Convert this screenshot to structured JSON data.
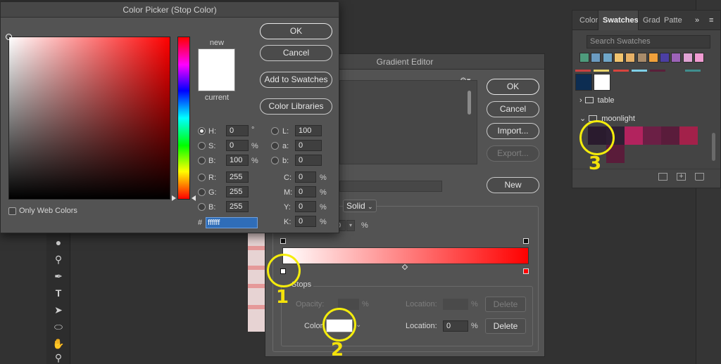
{
  "color_picker": {
    "title": "Color Picker (Stop Color)",
    "new_label": "new",
    "current_label": "current",
    "buttons": {
      "ok": "OK",
      "cancel": "Cancel",
      "add_to_swatches": "Add to Swatches",
      "color_libraries": "Color Libraries"
    },
    "only_web_colors": "Only Web Colors",
    "hsb": [
      {
        "label": "H:",
        "value": "0",
        "unit": "°",
        "selected": true
      },
      {
        "label": "S:",
        "value": "0",
        "unit": "%",
        "selected": false
      },
      {
        "label": "B:",
        "value": "100",
        "unit": "%",
        "selected": false
      }
    ],
    "rgb": [
      {
        "label": "R:",
        "value": "255"
      },
      {
        "label": "G:",
        "value": "255"
      },
      {
        "label": "B:",
        "value": "255"
      }
    ],
    "lab": [
      {
        "label": "L:",
        "value": "100"
      },
      {
        "label": "a:",
        "value": "0"
      },
      {
        "label": "b:",
        "value": "0"
      }
    ],
    "cmyk": [
      {
        "label": "C:",
        "value": "0",
        "unit": "%"
      },
      {
        "label": "M:",
        "value": "0",
        "unit": "%"
      },
      {
        "label": "Y:",
        "value": "0",
        "unit": "%"
      },
      {
        "label": "K:",
        "value": "0",
        "unit": "%"
      }
    ],
    "hex_prefix": "#",
    "hex_value": "ffffff"
  },
  "gradient_editor": {
    "title": "Gradient Editor",
    "buttons": {
      "ok": "OK",
      "cancel": "Cancel",
      "import": "Import...",
      "export": "Export...",
      "new": "New"
    },
    "gradient_type": "Solid",
    "smoothness_value": "0",
    "smoothness_unit": "%",
    "stops_title": "Stops",
    "opacity_label": "Opacity:",
    "opacity_unit": "%",
    "location_label_1": "Location:",
    "location_unit_1": "%",
    "delete_label_1": "Delete",
    "color_label": "Color:",
    "location_label_2": "Location:",
    "location_value_2": "0",
    "location_unit_2": "%",
    "delete_label_2": "Delete",
    "start_color": "#ffffff",
    "end_color": "#ff0000"
  },
  "swatches_panel": {
    "tabs": [
      "Color",
      "Swatches",
      "Grad",
      "Patte"
    ],
    "active_tab": "Swatches",
    "search_placeholder": "Search Swatches",
    "recent_colors": [
      "#4e9b7c",
      "#6b9bc1",
      "#6fa6c8",
      "#f2c46e",
      "#e6b066",
      "#a88b6a",
      "#f0a13b",
      "#4b3fa3",
      "#9c63b8",
      "#e0a3d4",
      "#f19bd2"
    ],
    "folders": [
      {
        "name": "table",
        "expanded": false
      },
      {
        "name": "moonlight",
        "expanded": true
      }
    ],
    "moonlight_swatches": [
      "#2a1b2e",
      "#2e1f33",
      "#b2235e",
      "#6b1f45",
      "#5a1c3b",
      "#a3214a",
      "#5a1c3a"
    ]
  },
  "annotations": [
    "1",
    "2",
    "3"
  ]
}
